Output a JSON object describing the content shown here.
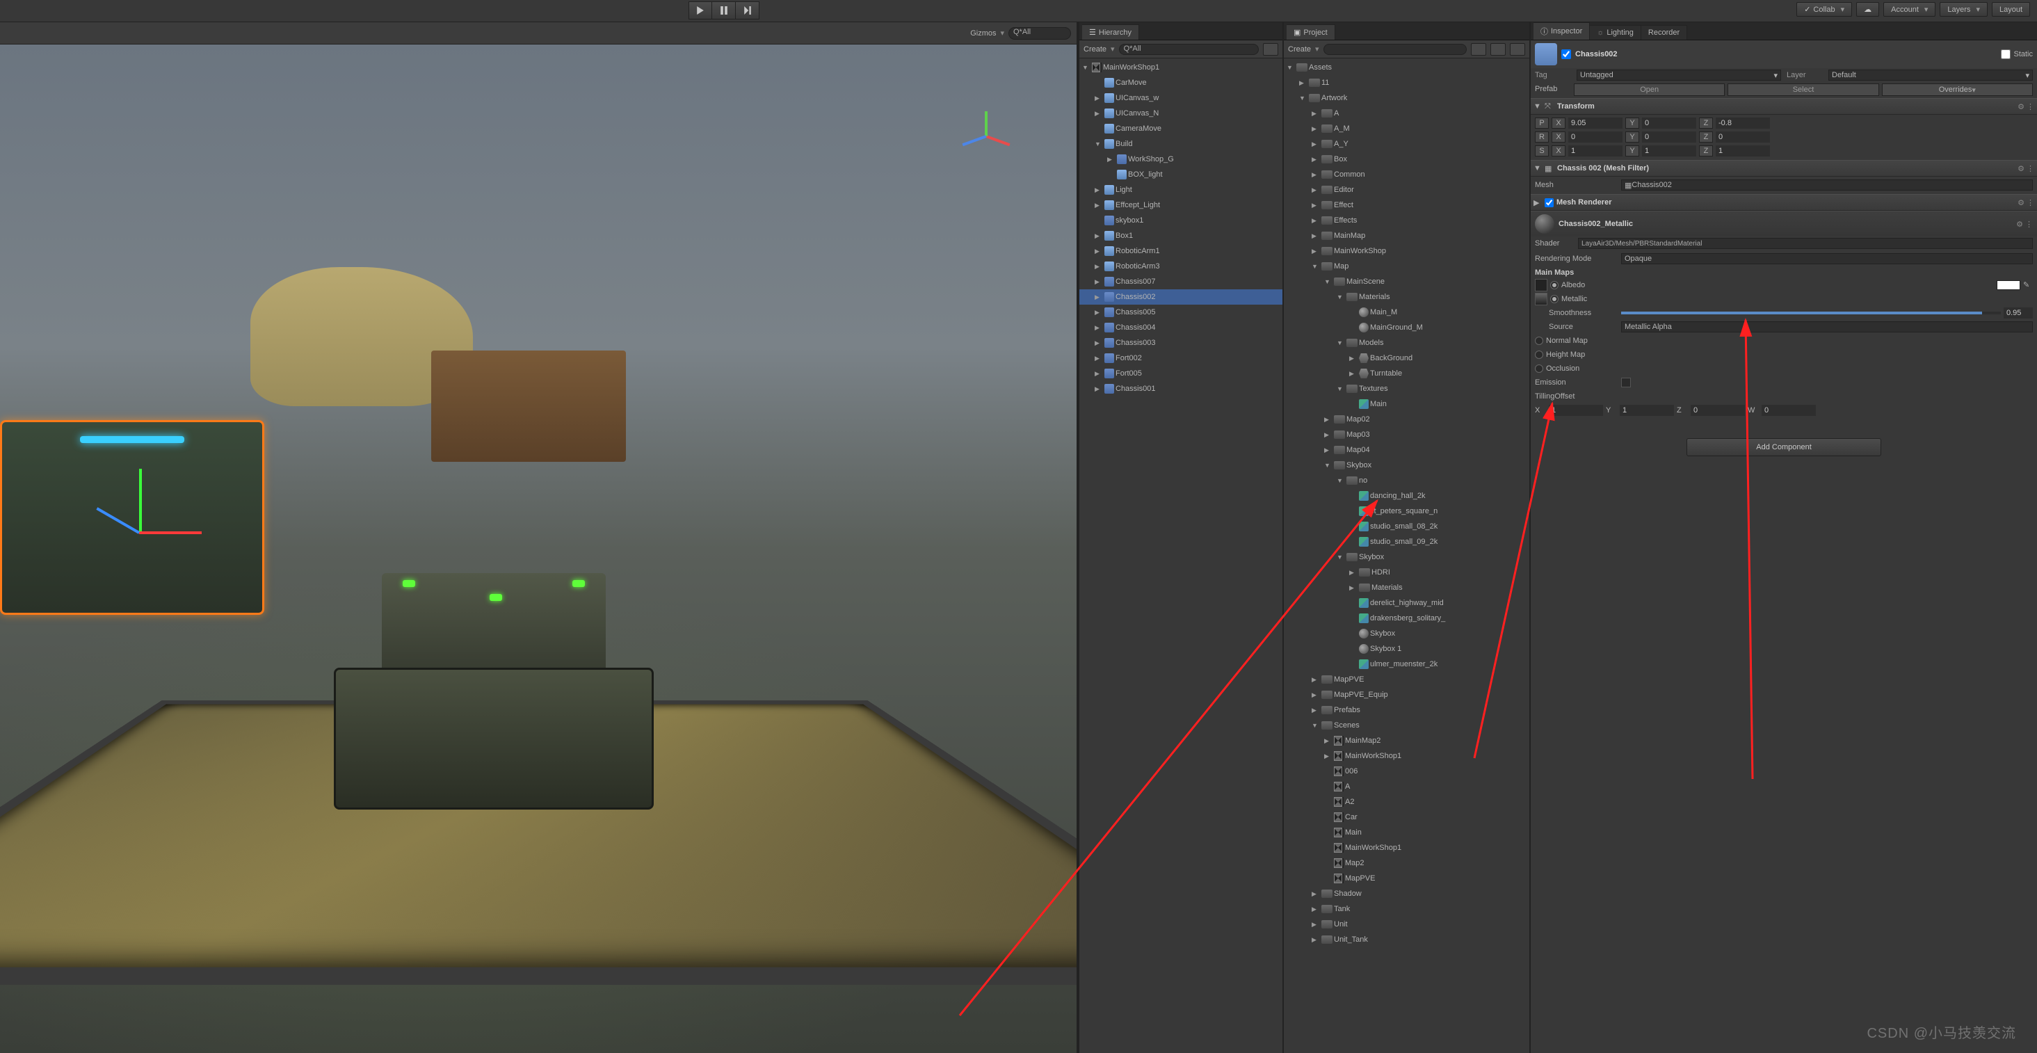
{
  "topbar": {
    "collab": "Collab",
    "account": "Account",
    "layers": "Layers",
    "layout": "Layout"
  },
  "sceneToolbar": {
    "gizmos": "Gizmos",
    "qAll": "Q*All"
  },
  "hierarchy": {
    "tab": "Hierarchy",
    "create": "Create",
    "qAll": "Q*All",
    "items": [
      {
        "depth": 0,
        "arrow": "▼",
        "ico": "scene",
        "label": "MainWorkShop1"
      },
      {
        "depth": 1,
        "arrow": "",
        "ico": "cube",
        "label": "CarMove"
      },
      {
        "depth": 1,
        "arrow": "▶",
        "ico": "cube",
        "label": "UICanvas_w"
      },
      {
        "depth": 1,
        "arrow": "▶",
        "ico": "cube",
        "label": "UICanvas_N"
      },
      {
        "depth": 1,
        "arrow": "",
        "ico": "cube",
        "label": "CameraMove"
      },
      {
        "depth": 1,
        "arrow": "▼",
        "ico": "cube",
        "label": "Build"
      },
      {
        "depth": 2,
        "arrow": "▶",
        "ico": "prefab",
        "label": "WorkShop_G",
        "highlight": true
      },
      {
        "depth": 2,
        "arrow": "",
        "ico": "cube",
        "label": "BOX_light"
      },
      {
        "depth": 1,
        "arrow": "▶",
        "ico": "cube",
        "label": "Light"
      },
      {
        "depth": 1,
        "arrow": "▶",
        "ico": "cube",
        "label": "Effcept_Light"
      },
      {
        "depth": 1,
        "arrow": "",
        "ico": "prefab",
        "label": "skybox1",
        "highlight": true
      },
      {
        "depth": 1,
        "arrow": "▶",
        "ico": "cube",
        "label": "Box1"
      },
      {
        "depth": 1,
        "arrow": "▶",
        "ico": "cube",
        "label": "RoboticArm1"
      },
      {
        "depth": 1,
        "arrow": "▶",
        "ico": "cube",
        "label": "RoboticArm3"
      },
      {
        "depth": 1,
        "arrow": "▶",
        "ico": "prefab",
        "label": "Chassis007",
        "highlight": true
      },
      {
        "depth": 1,
        "arrow": "▶",
        "ico": "prefab",
        "label": "Chassis002",
        "selected": true
      },
      {
        "depth": 1,
        "arrow": "▶",
        "ico": "prefab",
        "label": "Chassis005",
        "highlight": true
      },
      {
        "depth": 1,
        "arrow": "▶",
        "ico": "prefab",
        "label": "Chassis004",
        "highlight": true
      },
      {
        "depth": 1,
        "arrow": "▶",
        "ico": "prefab",
        "label": "Chassis003",
        "highlight": true
      },
      {
        "depth": 1,
        "arrow": "▶",
        "ico": "prefab",
        "label": "Fort002",
        "highlight": true
      },
      {
        "depth": 1,
        "arrow": "▶",
        "ico": "prefab",
        "label": "Fort005",
        "highlight": true
      },
      {
        "depth": 1,
        "arrow": "▶",
        "ico": "prefab",
        "label": "Chassis001",
        "highlight": true
      }
    ]
  },
  "project": {
    "tab": "Project",
    "create": "Create",
    "items": [
      {
        "depth": 0,
        "arrow": "▼",
        "ico": "folder",
        "label": "Assets"
      },
      {
        "depth": 1,
        "arrow": "▶",
        "ico": "folder",
        "label": "11"
      },
      {
        "depth": 1,
        "arrow": "▼",
        "ico": "folder",
        "label": "Artwork"
      },
      {
        "depth": 2,
        "arrow": "▶",
        "ico": "folder",
        "label": "A"
      },
      {
        "depth": 2,
        "arrow": "▶",
        "ico": "folder",
        "label": "A_M"
      },
      {
        "depth": 2,
        "arrow": "▶",
        "ico": "folder",
        "label": "A_Y"
      },
      {
        "depth": 2,
        "arrow": "▶",
        "ico": "folder",
        "label": "Box"
      },
      {
        "depth": 2,
        "arrow": "▶",
        "ico": "folder",
        "label": "Common"
      },
      {
        "depth": 2,
        "arrow": "▶",
        "ico": "folder",
        "label": "Editor"
      },
      {
        "depth": 2,
        "arrow": "▶",
        "ico": "folder",
        "label": "Effect"
      },
      {
        "depth": 2,
        "arrow": "▶",
        "ico": "folder",
        "label": "Effects"
      },
      {
        "depth": 2,
        "arrow": "▶",
        "ico": "folder",
        "label": "MainMap"
      },
      {
        "depth": 2,
        "arrow": "▶",
        "ico": "folder",
        "label": "MainWorkShop"
      },
      {
        "depth": 2,
        "arrow": "▼",
        "ico": "folder",
        "label": "Map"
      },
      {
        "depth": 3,
        "arrow": "▼",
        "ico": "folder",
        "label": "MainScene"
      },
      {
        "depth": 4,
        "arrow": "▼",
        "ico": "folder",
        "label": "Materials"
      },
      {
        "depth": 5,
        "arrow": "",
        "ico": "mat",
        "label": "Main_M"
      },
      {
        "depth": 5,
        "arrow": "",
        "ico": "mat",
        "label": "MainGround_M"
      },
      {
        "depth": 4,
        "arrow": "▼",
        "ico": "folder",
        "label": "Models"
      },
      {
        "depth": 5,
        "arrow": "▶",
        "ico": "mesh",
        "label": "BackGround"
      },
      {
        "depth": 5,
        "arrow": "▶",
        "ico": "mesh",
        "label": "Turntable"
      },
      {
        "depth": 4,
        "arrow": "▼",
        "ico": "folder",
        "label": "Textures"
      },
      {
        "depth": 5,
        "arrow": "",
        "ico": "tex",
        "label": "Main"
      },
      {
        "depth": 3,
        "arrow": "▶",
        "ico": "folder",
        "label": "Map02"
      },
      {
        "depth": 3,
        "arrow": "▶",
        "ico": "folder",
        "label": "Map03"
      },
      {
        "depth": 3,
        "arrow": "▶",
        "ico": "folder",
        "label": "Map04"
      },
      {
        "depth": 3,
        "arrow": "▼",
        "ico": "folder",
        "label": "Skybox"
      },
      {
        "depth": 4,
        "arrow": "▼",
        "ico": "folder",
        "label": "no"
      },
      {
        "depth": 5,
        "arrow": "",
        "ico": "tex",
        "label": "dancing_hall_2k"
      },
      {
        "depth": 5,
        "arrow": "",
        "ico": "tex",
        "label": "st_peters_square_n"
      },
      {
        "depth": 5,
        "arrow": "",
        "ico": "tex",
        "label": "studio_small_08_2k"
      },
      {
        "depth": 5,
        "arrow": "",
        "ico": "tex",
        "label": "studio_small_09_2k"
      },
      {
        "depth": 4,
        "arrow": "▼",
        "ico": "folder",
        "label": "Skybox"
      },
      {
        "depth": 5,
        "arrow": "▶",
        "ico": "folder",
        "label": "HDRI"
      },
      {
        "depth": 5,
        "arrow": "▶",
        "ico": "folder",
        "label": "Materials"
      },
      {
        "depth": 5,
        "arrow": "",
        "ico": "tex",
        "label": "derelict_highway_mid"
      },
      {
        "depth": 5,
        "arrow": "",
        "ico": "tex",
        "label": "drakensberg_solitary_"
      },
      {
        "depth": 5,
        "arrow": "",
        "ico": "mat",
        "label": "Skybox"
      },
      {
        "depth": 5,
        "arrow": "",
        "ico": "mat",
        "label": "Skybox 1"
      },
      {
        "depth": 5,
        "arrow": "",
        "ico": "tex",
        "label": "ulmer_muenster_2k"
      },
      {
        "depth": 2,
        "arrow": "▶",
        "ico": "folder",
        "label": "MapPVE"
      },
      {
        "depth": 2,
        "arrow": "▶",
        "ico": "folder",
        "label": "MapPVE_Equip"
      },
      {
        "depth": 2,
        "arrow": "▶",
        "ico": "folder",
        "label": "Prefabs"
      },
      {
        "depth": 2,
        "arrow": "▼",
        "ico": "folder",
        "label": "Scenes"
      },
      {
        "depth": 3,
        "arrow": "▶",
        "ico": "scene",
        "label": "MainMap2"
      },
      {
        "depth": 3,
        "arrow": "▶",
        "ico": "scene",
        "label": "MainWorkShop1"
      },
      {
        "depth": 3,
        "arrow": "",
        "ico": "scene",
        "label": "006"
      },
      {
        "depth": 3,
        "arrow": "",
        "ico": "scene",
        "label": "A"
      },
      {
        "depth": 3,
        "arrow": "",
        "ico": "scene",
        "label": "A2"
      },
      {
        "depth": 3,
        "arrow": "",
        "ico": "scene",
        "label": "Car"
      },
      {
        "depth": 3,
        "arrow": "",
        "ico": "scene",
        "label": "Main"
      },
      {
        "depth": 3,
        "arrow": "",
        "ico": "scene",
        "label": "MainWorkShop1"
      },
      {
        "depth": 3,
        "arrow": "",
        "ico": "scene",
        "label": "Map2"
      },
      {
        "depth": 3,
        "arrow": "",
        "ico": "scene",
        "label": "MapPVE"
      },
      {
        "depth": 2,
        "arrow": "▶",
        "ico": "folder",
        "label": "Shadow"
      },
      {
        "depth": 2,
        "arrow": "▶",
        "ico": "folder",
        "label": "Tank"
      },
      {
        "depth": 2,
        "arrow": "▶",
        "ico": "folder",
        "label": "Unit"
      },
      {
        "depth": 2,
        "arrow": "▶",
        "ico": "folder",
        "label": "Unit_Tank"
      }
    ]
  },
  "inspector": {
    "tabs": {
      "inspector": "Inspector",
      "lighting": "Lighting",
      "recorder": "Recorder"
    },
    "objectName": "Chassis002",
    "static": "Static",
    "tag_label": "Tag",
    "tag_value": "Untagged",
    "layer_label": "Layer",
    "layer_value": "Default",
    "prefab_label": "Prefab",
    "prefab_open": "Open",
    "prefab_select": "Select",
    "prefab_overrides": "Overrides",
    "transform": {
      "title": "Transform",
      "p": "P",
      "r": "R",
      "s": "S",
      "px": "9.05",
      "py": "0",
      "pz": "-0.8",
      "rx": "0",
      "ry": "0",
      "rz": "0",
      "sx": "1",
      "sy": "1",
      "sz": "1",
      "xl": "X",
      "yl": "Y",
      "zl": "Z"
    },
    "meshFilter": {
      "title": "Chassis 002 (Mesh Filter)",
      "meshLabel": "Mesh",
      "meshValue": "Chassis002"
    },
    "meshRenderer": {
      "title": "Mesh Renderer"
    },
    "material": {
      "name": "Chassis002_Metallic",
      "shaderLabel": "Shader",
      "shaderValue": "LayaAir3D/Mesh/PBRStandardMaterial",
      "renderingMode": "Rendering Mode",
      "renderingModeValue": "Opaque",
      "mainMaps": "Main Maps",
      "albedo": "Albedo",
      "metallic": "Metallic",
      "smoothness": "Smoothness",
      "smoothnessValue": "0.95",
      "source": "Source",
      "sourceValue": "Metallic Alpha",
      "normal": "Normal Map",
      "height": "Height Map",
      "occlusion": "Occlusion",
      "emission": "Emission",
      "tiling": "TillingOffset",
      "tx": "1",
      "ty": "1",
      "tz": "0",
      "tw": "0",
      "xl": "X",
      "yl": "Y",
      "zl": "Z",
      "wl": "W"
    },
    "addComponent": "Add Component"
  },
  "watermark": "CSDN @小马技羡交流"
}
